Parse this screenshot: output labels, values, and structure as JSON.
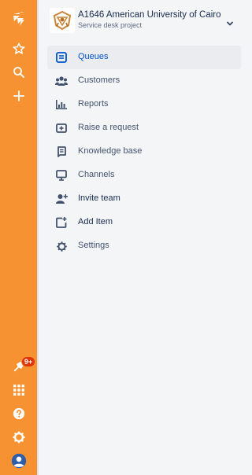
{
  "global_nav": {
    "notification_badge": "9+",
    "colors": {
      "rail": "#f79232",
      "badge": "#de350b"
    },
    "top_icons": [
      "jira-logo-icon",
      "star-icon",
      "search-icon",
      "plus-icon"
    ],
    "bottom_icons": [
      "notifications-icon",
      "app-switcher-icon",
      "help-icon",
      "settings-icon",
      "profile-avatar-icon"
    ]
  },
  "project": {
    "name": "A1646 American University of Cairo",
    "type": "Service desk project"
  },
  "sidebar": {
    "items": [
      {
        "label": "Queues",
        "icon": "queues-icon",
        "active": true
      },
      {
        "label": "Customers",
        "icon": "customers-icon"
      },
      {
        "label": "Reports",
        "icon": "reports-icon"
      },
      {
        "label": "Raise a request",
        "icon": "raise-request-icon"
      },
      {
        "label": "Knowledge base",
        "icon": "knowledge-base-icon"
      },
      {
        "label": "Channels",
        "icon": "channels-icon"
      },
      {
        "label": "Invite team",
        "icon": "invite-team-icon"
      },
      {
        "label": "Add Item",
        "icon": "add-item-icon"
      },
      {
        "label": "Settings",
        "icon": "settings-icon"
      }
    ]
  },
  "colors": {
    "active_text": "#0052cc",
    "text": "#42526e",
    "sidebar_bg": "#f4f5f7"
  }
}
